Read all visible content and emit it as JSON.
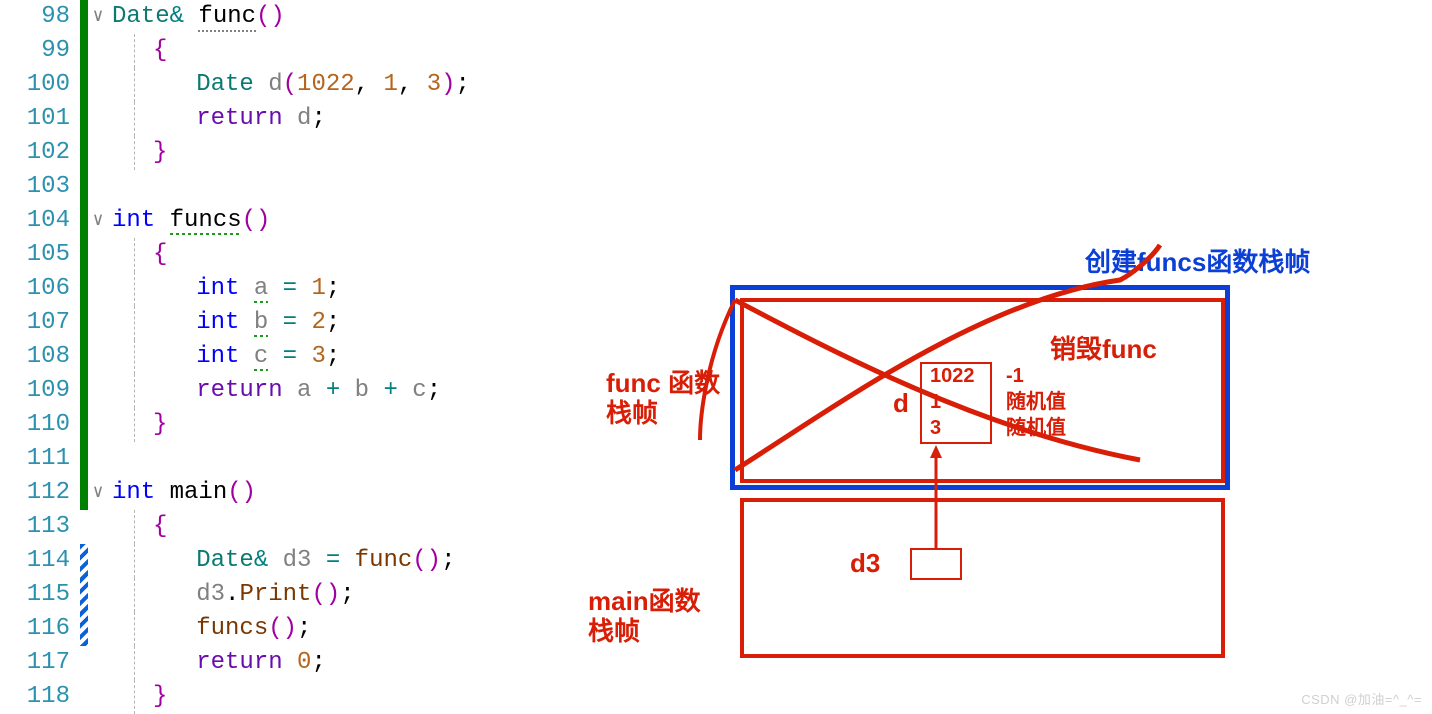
{
  "lines": {
    "98": "98",
    "99": "99",
    "100": "100",
    "101": "101",
    "102": "102",
    "103": "103",
    "104": "104",
    "105": "105",
    "106": "106",
    "107": "107",
    "108": "108",
    "109": "109",
    "110": "110",
    "111": "111",
    "112": "112",
    "113": "113",
    "114": "114",
    "115": "115",
    "116": "116",
    "117": "117",
    "118": "118"
  },
  "fold_glyph": "∨",
  "code": {
    "date_type": "Date",
    "amp": "&",
    "space": " ",
    "func_name": "func",
    "funcs_name": "funcs",
    "main_name": "main",
    "parens": "()",
    "lparen": "(",
    "rparen": ")",
    "lbrace": "{",
    "rbrace": "}",
    "date_var": "d",
    "date_args_1": "1022",
    "date_args_2": "1",
    "date_args_3": "3",
    "comma": ", ",
    "semi": ";",
    "return_kw": "return",
    "int_kw": "int",
    "a": "a",
    "b": "b",
    "c": "c",
    "eq": " = ",
    "n1": "1",
    "n2": "2",
    "n3": "3",
    "plus": " + ",
    "d3": "d3",
    "print_call": "Print",
    "dot": ".",
    "zero": "0"
  },
  "diagram": {
    "funcs_label": "创建funcs函数栈帧",
    "func_frame_label_1": "func 函数",
    "func_frame_label_2": "栈帧",
    "destroy_func": "销毁func",
    "d_label": "d",
    "d_vals": {
      "v1": "1022",
      "v2": "1",
      "v3": "3"
    },
    "side_vals": {
      "s1": "-1",
      "s2": "随机值",
      "s3": "随机值"
    },
    "main_frame_label_1": "main函数",
    "main_frame_label_2": "栈帧",
    "d3_label": "d3"
  },
  "watermark": "CSDN @加油=^_^="
}
